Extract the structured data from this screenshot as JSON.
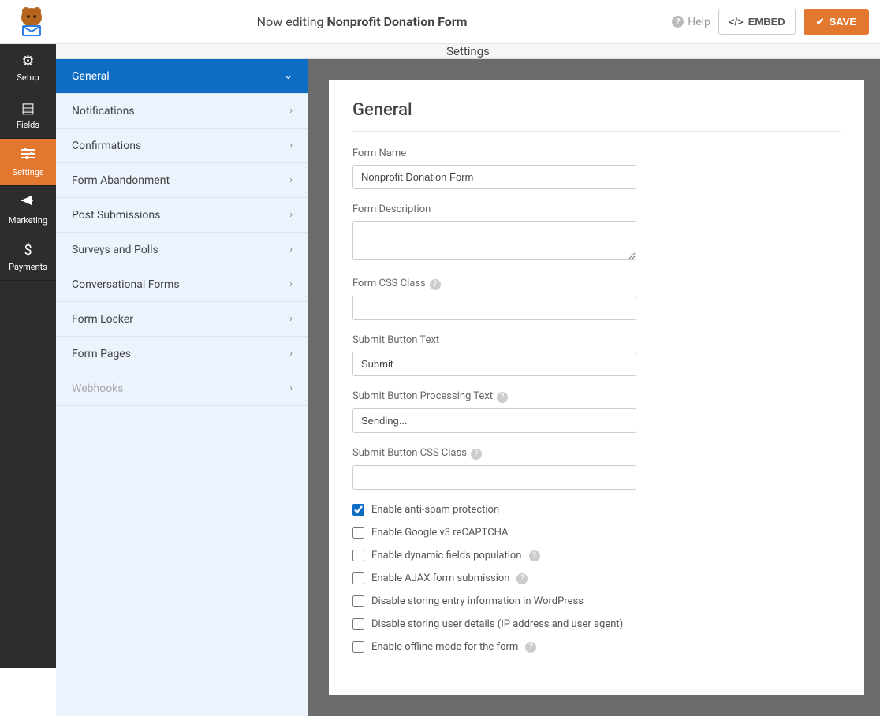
{
  "topbar": {
    "editing_prefix": "Now editing ",
    "form_title": "Nonprofit Donation Form",
    "help_label": "Help",
    "embed_label": "EMBED",
    "save_label": "SAVE"
  },
  "rail": {
    "items": [
      {
        "label": "Setup"
      },
      {
        "label": "Fields"
      },
      {
        "label": "Settings"
      },
      {
        "label": "Marketing"
      },
      {
        "label": "Payments"
      }
    ]
  },
  "settings_header": "Settings",
  "side_panel": {
    "items": [
      {
        "label": "General",
        "active": true,
        "chev": "⌄"
      },
      {
        "label": "Notifications"
      },
      {
        "label": "Confirmations"
      },
      {
        "label": "Form Abandonment"
      },
      {
        "label": "Post Submissions"
      },
      {
        "label": "Surveys and Polls"
      },
      {
        "label": "Conversational Forms"
      },
      {
        "label": "Form Locker"
      },
      {
        "label": "Form Pages"
      },
      {
        "label": "Webhooks",
        "disabled": true
      }
    ]
  },
  "card": {
    "title": "General",
    "fields": {
      "form_name": {
        "label": "Form Name",
        "value": "Nonprofit Donation Form"
      },
      "form_description": {
        "label": "Form Description",
        "value": ""
      },
      "form_css_class": {
        "label": "Form CSS Class",
        "value": "",
        "help": true
      },
      "submit_text": {
        "label": "Submit Button Text",
        "value": "Submit"
      },
      "submit_processing": {
        "label": "Submit Button Processing Text",
        "value": "Sending...",
        "help": true
      },
      "submit_css": {
        "label": "Submit Button CSS Class",
        "value": "",
        "help": true
      }
    },
    "checks": [
      {
        "label": "Enable anti-spam protection",
        "checked": true
      },
      {
        "label": "Enable Google v3 reCAPTCHA",
        "checked": false
      },
      {
        "label": "Enable dynamic fields population",
        "checked": false,
        "help": true
      },
      {
        "label": "Enable AJAX form submission",
        "checked": false,
        "help": true
      },
      {
        "label": "Disable storing entry information in WordPress",
        "checked": false
      },
      {
        "label": "Disable storing user details (IP address and user agent)",
        "checked": false
      },
      {
        "label": "Enable offline mode for the form",
        "checked": false,
        "help": true
      }
    ]
  }
}
